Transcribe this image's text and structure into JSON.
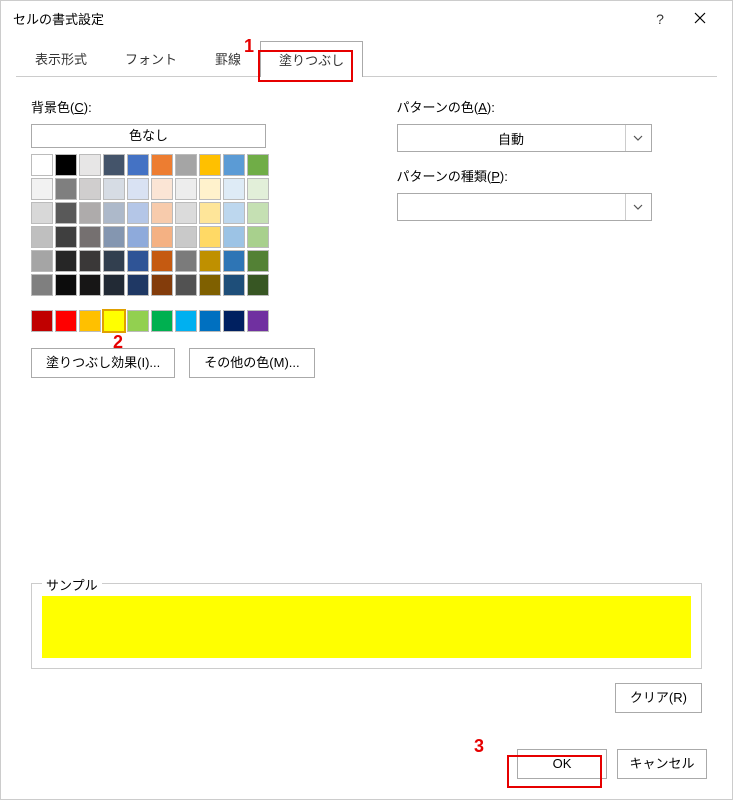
{
  "title": "セルの書式設定",
  "tabs": [
    "表示形式",
    "フォント",
    "罫線",
    "塗りつぶし"
  ],
  "activeTab": 3,
  "bgColorLabelPre": "背景色(",
  "bgColorLabelKey": "C",
  "bgColorLabelPost": "):",
  "noColor": "色なし",
  "themeColors": [
    "#ffffff",
    "#000000",
    "#e7e6e6",
    "#44546a",
    "#4472c4",
    "#ed7d31",
    "#a5a5a5",
    "#ffc000",
    "#5b9bd5",
    "#70ad47",
    "#f2f2f2",
    "#7f7f7f",
    "#d0cece",
    "#d6dce4",
    "#d9e2f3",
    "#fbe5d5",
    "#ededed",
    "#fff2cc",
    "#deebf6",
    "#e2efd9",
    "#d8d8d8",
    "#595959",
    "#aeabab",
    "#adb9ca",
    "#b4c6e7",
    "#f7cbac",
    "#dbdbdb",
    "#fee599",
    "#bdd7ee",
    "#c5e0b3",
    "#bfbfbf",
    "#3f3f3f",
    "#757070",
    "#8496b0",
    "#8eaadb",
    "#f4b183",
    "#c9c9c9",
    "#ffd965",
    "#9cc3e5",
    "#a8d08d",
    "#a5a5a5",
    "#262626",
    "#3a3838",
    "#323f4f",
    "#2f5496",
    "#c55a11",
    "#7b7b7b",
    "#bf9000",
    "#2e75b5",
    "#538135",
    "#7f7f7f",
    "#0c0c0c",
    "#171616",
    "#222a35",
    "#1f3864",
    "#833c0b",
    "#525252",
    "#7f6000",
    "#1e4e79",
    "#375623"
  ],
  "standardColors": [
    "#c00000",
    "#ff0000",
    "#ffc000",
    "#ffff00",
    "#92d050",
    "#00b050",
    "#00b0f0",
    "#0070c0",
    "#002060",
    "#7030a0"
  ],
  "selectedStandardIndex": 3,
  "fillEffectsPre": "塗りつぶし効果(",
  "fillEffectsKey": "I",
  "fillEffectsPost": ")...",
  "moreColorsPre": "その他の色(",
  "moreColorsKey": "M",
  "moreColorsPost": ")...",
  "patternColorLabelPre": "パターンの色(",
  "patternColorLabelKey": "A",
  "patternColorLabelPost": "):",
  "patternColorValue": "自動",
  "patternTypeLabelPre": "パターンの種類(",
  "patternTypeLabelKey": "P",
  "patternTypeLabelPost": "):",
  "patternTypeValue": "",
  "sampleLabel": "サンプル",
  "sampleColor": "#ffff00",
  "clearPre": "クリア(",
  "clearKey": "R",
  "clearPost": ")",
  "ok": "OK",
  "cancel": "キャンセル",
  "annotations": {
    "a1": "1",
    "a2": "2",
    "a3": "3"
  }
}
